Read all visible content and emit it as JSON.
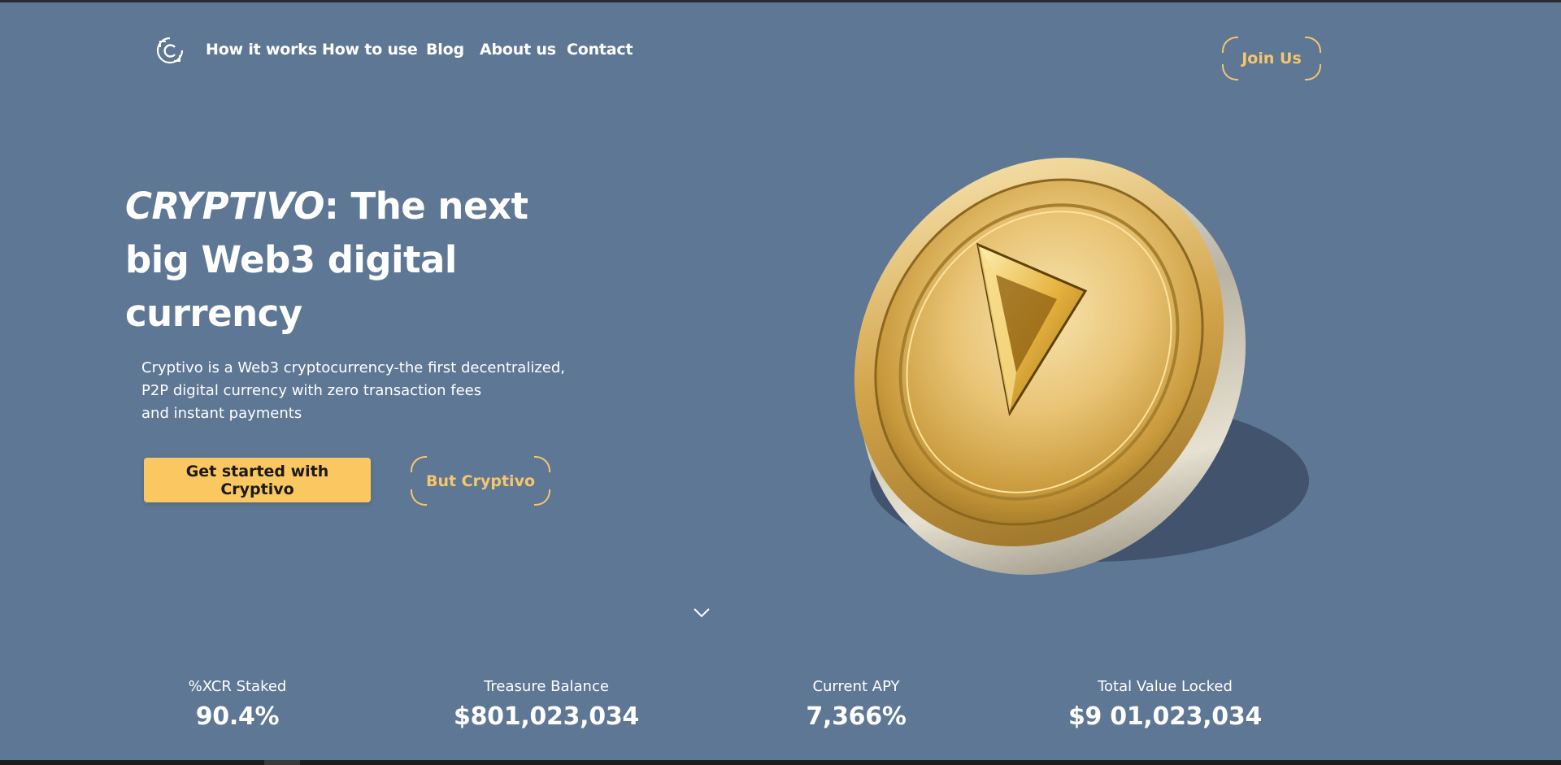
{
  "nav": {
    "logo_icon": "crypto-c-logo",
    "links": [
      {
        "label": "How it works"
      },
      {
        "label": "How to use"
      },
      {
        "label": "Blog"
      },
      {
        "label": "About us"
      },
      {
        "label": "Contact"
      }
    ],
    "join_label": "Join Us"
  },
  "hero": {
    "title_brand": "CRYPTIVO",
    "title_rest": ": The next big Web3 digital currency",
    "description_lines": [
      "Cryptivo is a Web3 cryptocurrency-the first decentralized,",
      "P2P digital currency with zero transaction fees",
      "and instant payments"
    ],
    "primary_cta": "Get started with Cryptivo",
    "secondary_cta": "But Cryptivo"
  },
  "scroll_icon": "chevron-down-icon",
  "stats": [
    {
      "label": "%XCR Staked",
      "value": "90.4%"
    },
    {
      "label": "Treasure Balance",
      "value": "$801,023,034"
    },
    {
      "label": "Current APY",
      "value": "7,366%"
    },
    {
      "label": "Total Value Locked",
      "value": "$9 01,023,034"
    }
  ],
  "colors": {
    "background": "#5e7795",
    "accent": "#fbc760",
    "text": "#ffffff"
  }
}
